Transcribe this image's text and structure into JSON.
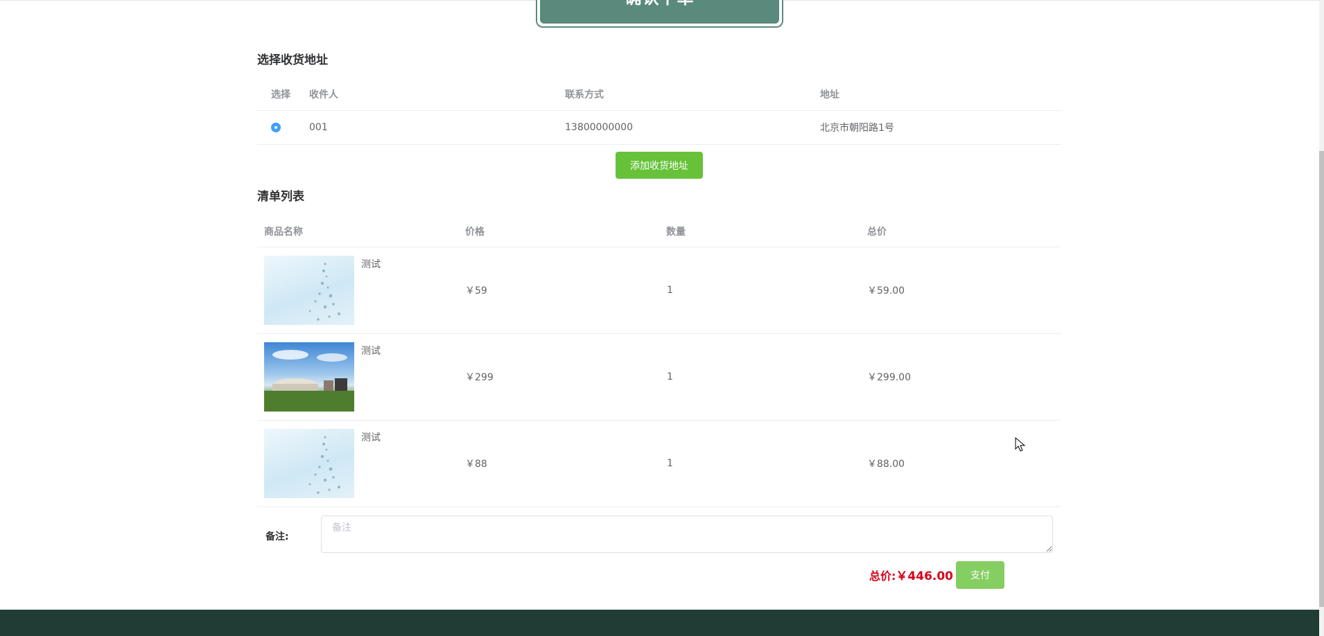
{
  "header": {
    "title": "确认下单"
  },
  "address": {
    "section_title": "选择收货地址",
    "columns": [
      "选择",
      "收件人",
      "联系方式",
      "地址"
    ],
    "rows": [
      {
        "recipient": "001",
        "phone": "13800000000",
        "address": "北京市朝阳路1号",
        "selected": true
      }
    ],
    "add_button": "添加收货地址"
  },
  "cart": {
    "section_title": "清单列表",
    "columns": [
      "商品名称",
      "价格",
      "数量",
      "总价"
    ],
    "items": [
      {
        "name": "测试",
        "price": "￥59",
        "quantity": "1",
        "subtotal": "￥59.00",
        "thumb": "sky"
      },
      {
        "name": "测试",
        "price": "￥299",
        "quantity": "1",
        "subtotal": "￥299.00",
        "thumb": "building"
      },
      {
        "name": "测试",
        "price": "￥88",
        "quantity": "1",
        "subtotal": "￥88.00",
        "thumb": "sky"
      }
    ]
  },
  "remark": {
    "label": "备注:",
    "placeholder": "备注",
    "value": ""
  },
  "summary": {
    "total_label": "总价:",
    "total_value": "￥446.00",
    "pay_button": "支付"
  },
  "colors": {
    "primary_green": "#67c23a",
    "pay_green": "#85ce61",
    "banner_green": "#5a8a7b",
    "footer": "#1f3d35",
    "total_red": "#d9001b",
    "radio_blue": "#409eff"
  }
}
